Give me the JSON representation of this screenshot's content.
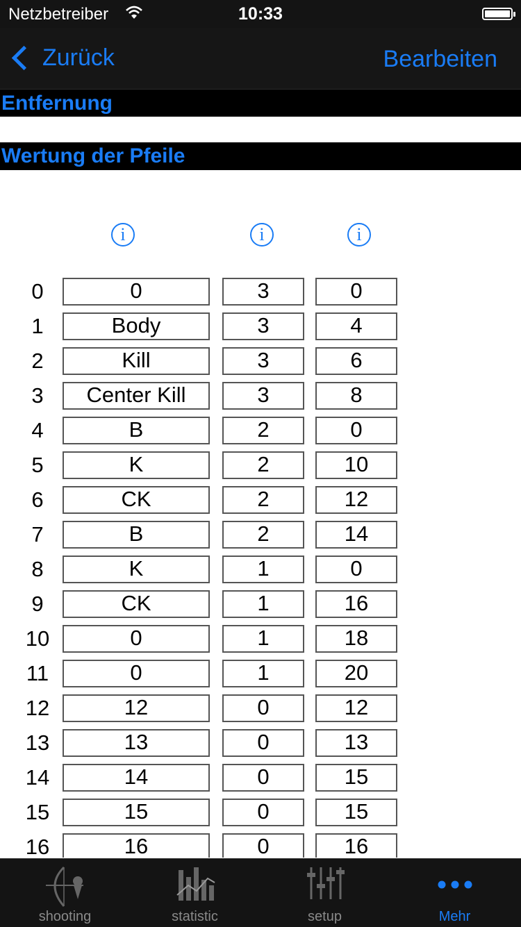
{
  "status": {
    "carrier": "Netzbetreiber",
    "time": "10:33"
  },
  "nav": {
    "back_label": "Zurück",
    "edit_label": "Bearbeiten"
  },
  "sections": {
    "distance": "Entfernung",
    "arrow_scoring": "Wertung der Pfeile"
  },
  "info_icons": [
    "i",
    "i",
    "i"
  ],
  "rows": [
    {
      "num": "0",
      "a": "0",
      "b": "3",
      "c": "0"
    },
    {
      "num": "1",
      "a": "Body",
      "b": "3",
      "c": "4"
    },
    {
      "num": "2",
      "a": "Kill",
      "b": "3",
      "c": "6"
    },
    {
      "num": "3",
      "a": "Center Kill",
      "b": "3",
      "c": "8"
    },
    {
      "num": "4",
      "a": "B",
      "b": "2",
      "c": "0"
    },
    {
      "num": "5",
      "a": "K",
      "b": "2",
      "c": "10"
    },
    {
      "num": "6",
      "a": "CK",
      "b": "2",
      "c": "12"
    },
    {
      "num": "7",
      "a": "B",
      "b": "2",
      "c": "14"
    },
    {
      "num": "8",
      "a": "K",
      "b": "1",
      "c": "0"
    },
    {
      "num": "9",
      "a": "CK",
      "b": "1",
      "c": "16"
    },
    {
      "num": "10",
      "a": "0",
      "b": "1",
      "c": "18"
    },
    {
      "num": "11",
      "a": "0",
      "b": "1",
      "c": "20"
    },
    {
      "num": "12",
      "a": "12",
      "b": "0",
      "c": "12"
    },
    {
      "num": "13",
      "a": "13",
      "b": "0",
      "c": "13"
    },
    {
      "num": "14",
      "a": "14",
      "b": "0",
      "c": "15"
    },
    {
      "num": "15",
      "a": "15",
      "b": "0",
      "c": "15"
    },
    {
      "num": "16",
      "a": "16",
      "b": "0",
      "c": "16"
    }
  ],
  "tabs": [
    {
      "label": "shooting",
      "icon": "archer-icon",
      "active": false
    },
    {
      "label": "statistic",
      "icon": "statistic-icon",
      "active": false
    },
    {
      "label": "setup",
      "icon": "sliders-icon",
      "active": false
    },
    {
      "label": "Mehr",
      "icon": "more-dots-icon",
      "active": true
    }
  ],
  "colors": {
    "accent": "#1a7cf5",
    "bar": "#141414"
  }
}
